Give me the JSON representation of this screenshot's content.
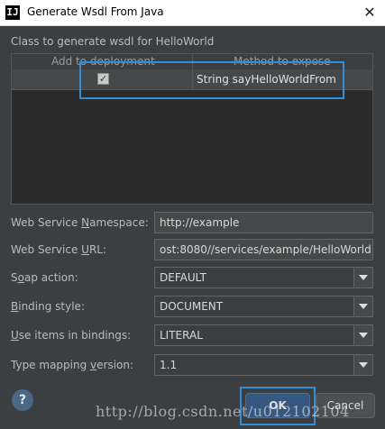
{
  "window": {
    "icon_text": "IJ",
    "title": "Generate Wsdl From Java",
    "close_glyph": "✕"
  },
  "section_label": "Class to generate wsdl for HelloWorld",
  "table": {
    "columns": [
      "Add to deployment",
      "Method to expose"
    ],
    "rows": [
      {
        "add_to_deployment": true,
        "checkbox_glyph": "✓",
        "method": "String sayHelloWorldFrom"
      }
    ]
  },
  "form": {
    "namespace": {
      "label_pre": "Web Service ",
      "label_mnemonic": "N",
      "label_post": "amespace:",
      "value": "http://example"
    },
    "url": {
      "label_pre": "Web Service ",
      "label_mnemonic": "U",
      "label_post": "RL:",
      "value": "ost:8080//services/example/HelloWorld"
    },
    "soap_action": {
      "label_pre": "S",
      "label_mnemonic": "o",
      "label_post": "ap action:",
      "value": "DEFAULT"
    },
    "binding_style": {
      "label_pre": "",
      "label_mnemonic": "B",
      "label_post": "inding style:",
      "value": "DOCUMENT"
    },
    "use_items": {
      "label_pre": "",
      "label_mnemonic": "U",
      "label_post": "se items in bindings:",
      "value": "LITERAL"
    },
    "type_mapping": {
      "label_pre": "Type mapping ",
      "label_mnemonic": "v",
      "label_post": "ersion:",
      "value": "1.1"
    }
  },
  "buttons": {
    "help": "?",
    "ok": "OK",
    "cancel": "Cancel"
  },
  "watermark": "http://blog.csdn.net/u012102104",
  "colors": {
    "dialog_bg": "#3c3f41",
    "highlight_border": "#2f8fd8",
    "ok_button": "#365880"
  }
}
